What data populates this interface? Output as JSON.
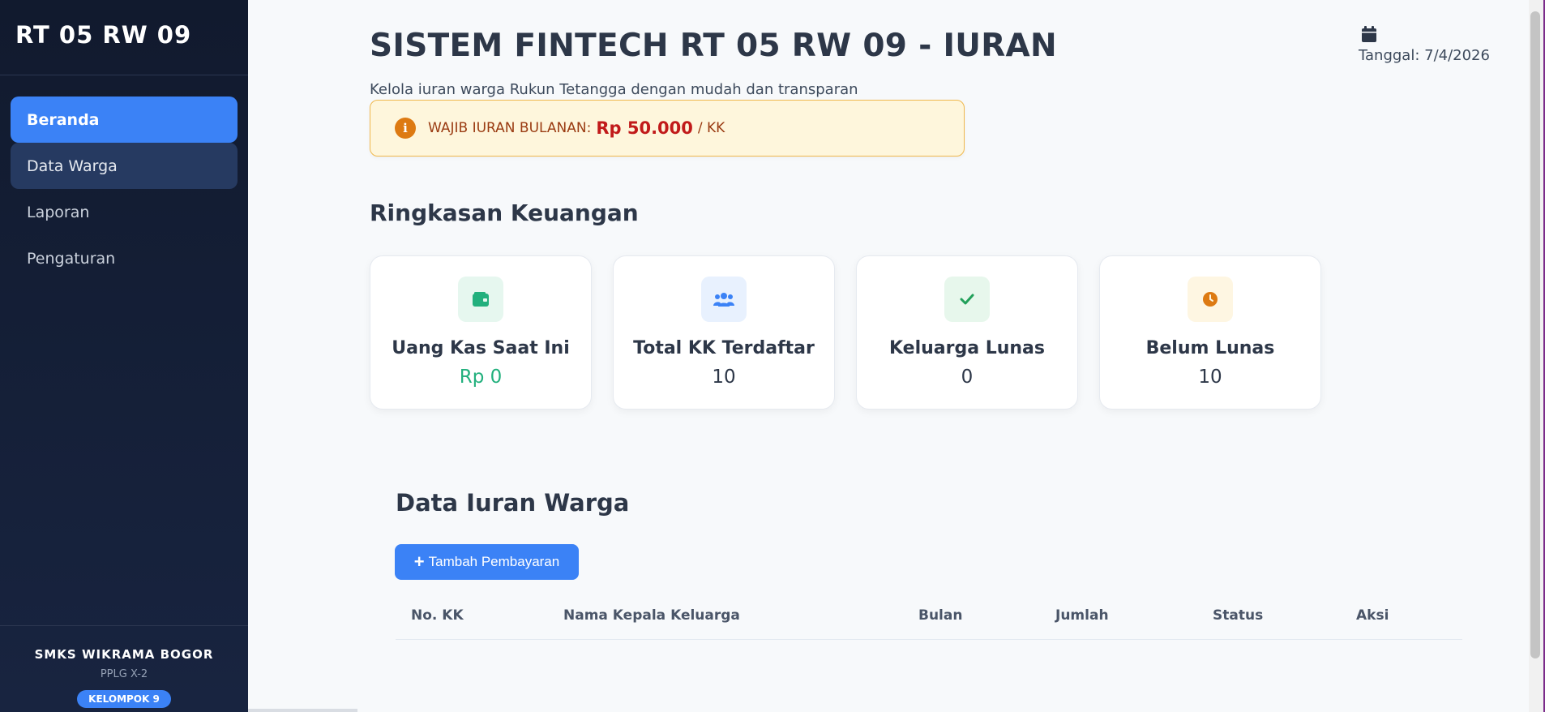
{
  "sidebar": {
    "brand": "RT 05 RW 09",
    "items": [
      {
        "label": "Beranda"
      },
      {
        "label": "Data Warga"
      },
      {
        "label": "Laporan"
      },
      {
        "label": "Pengaturan"
      }
    ],
    "footer": {
      "school": "SMKS WIKRAMA BOGOR",
      "class": "PPLG X-2",
      "badge": "KELOMPOK 9"
    }
  },
  "header": {
    "title": "SISTEM FINTECH RT 05 RW 09 - IURAN",
    "subtitle": "Kelola iuran warga Rukun Tetangga dengan mudah dan transparan",
    "date": "Tanggal: 7/4/2026"
  },
  "notice": {
    "label": "WAJIB IURAN BULANAN:",
    "amount": "Rp 50.000",
    "unit": "/ KK"
  },
  "summary": {
    "title": "Ringkasan Keuangan",
    "cards": [
      {
        "title": "Uang Kas Saat Ini",
        "value": "Rp 0",
        "icon": "wallet-icon",
        "color": "#22b07d"
      },
      {
        "title": "Total KK Terdaftar",
        "value": "10",
        "icon": "users-icon",
        "color": "#3b82f6"
      },
      {
        "title": "Keluarga Lunas",
        "value": "0",
        "icon": "check-icon",
        "color": "#22a05a"
      },
      {
        "title": "Belum Lunas",
        "value": "10",
        "icon": "clock-icon",
        "color": "#dd7a12"
      }
    ]
  },
  "data_iuran": {
    "title": "Data Iuran Warga",
    "add_button": "Tambah Pembayaran",
    "columns": [
      "No. KK",
      "Nama Kepala Keluarga",
      "Bulan",
      "Jumlah",
      "Status",
      "Aksi"
    ],
    "rows": []
  },
  "colors": {
    "accent": "#3b82f6",
    "sidebar_bg": "#111a2e",
    "notice_bg": "#fef6dc",
    "amount": "#c11a1a"
  }
}
